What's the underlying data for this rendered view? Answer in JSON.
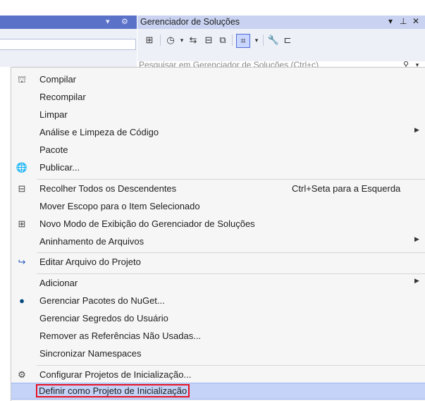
{
  "left_panel": {
    "controls": {
      "dropdown": "▾",
      "gear": "⚙"
    }
  },
  "solution_explorer": {
    "title": "Gerenciador de Soluções",
    "controls": {
      "dropdown": "▾",
      "pin": "⊥",
      "close": "✕"
    },
    "search_placeholder": "Pesquisar em Gerenciador de Soluções (Ctrl+ç)",
    "toolbar_icons": [
      "switch-views-icon",
      "history-icon",
      "sync-icon",
      "collapse-all-icon",
      "show-all-files-icon",
      "filter-icon",
      "properties-icon",
      "preview-icon"
    ]
  },
  "menu": {
    "items": [
      {
        "label": "Compilar",
        "icon": "build-icon"
      },
      {
        "label": "Recompilar"
      },
      {
        "label": "Limpar"
      },
      {
        "label": "Análise e Limpeza de Código",
        "submenu": true
      },
      {
        "label": "Pacote"
      },
      {
        "label": "Publicar...",
        "icon": "publish-globe-icon"
      },
      {
        "label": "Recolher Todos os Descendentes",
        "icon": "collapse-icon",
        "shortcut": "Ctrl+Seta para a Esquerda"
      },
      {
        "label": "Mover Escopo para o Item Selecionado"
      },
      {
        "label": "Novo Modo de Exibição do Gerenciador de Soluções",
        "icon": "new-view-icon"
      },
      {
        "label": "Aninhamento de Arquivos",
        "submenu": true
      },
      {
        "label": "Editar Arquivo do Projeto",
        "icon": "edit-arrow-icon"
      },
      {
        "label": "Adicionar",
        "submenu": true
      },
      {
        "label": "Gerenciar Pacotes do NuGet...",
        "icon": "nuget-icon"
      },
      {
        "label": "Gerenciar Segredos do Usuário"
      },
      {
        "label": "Remover as Referências Não Usadas..."
      },
      {
        "label": "Sincronizar Namespaces"
      },
      {
        "label": "Configurar Projetos de Inicialização...",
        "icon": "gear-icon"
      },
      {
        "label": "Definir como Projeto de Inicialização",
        "selected": true
      }
    ]
  },
  "colors": {
    "accent": "#5b72c9",
    "highlight": "#c4d3f7",
    "focus_outline": "#e81123"
  }
}
